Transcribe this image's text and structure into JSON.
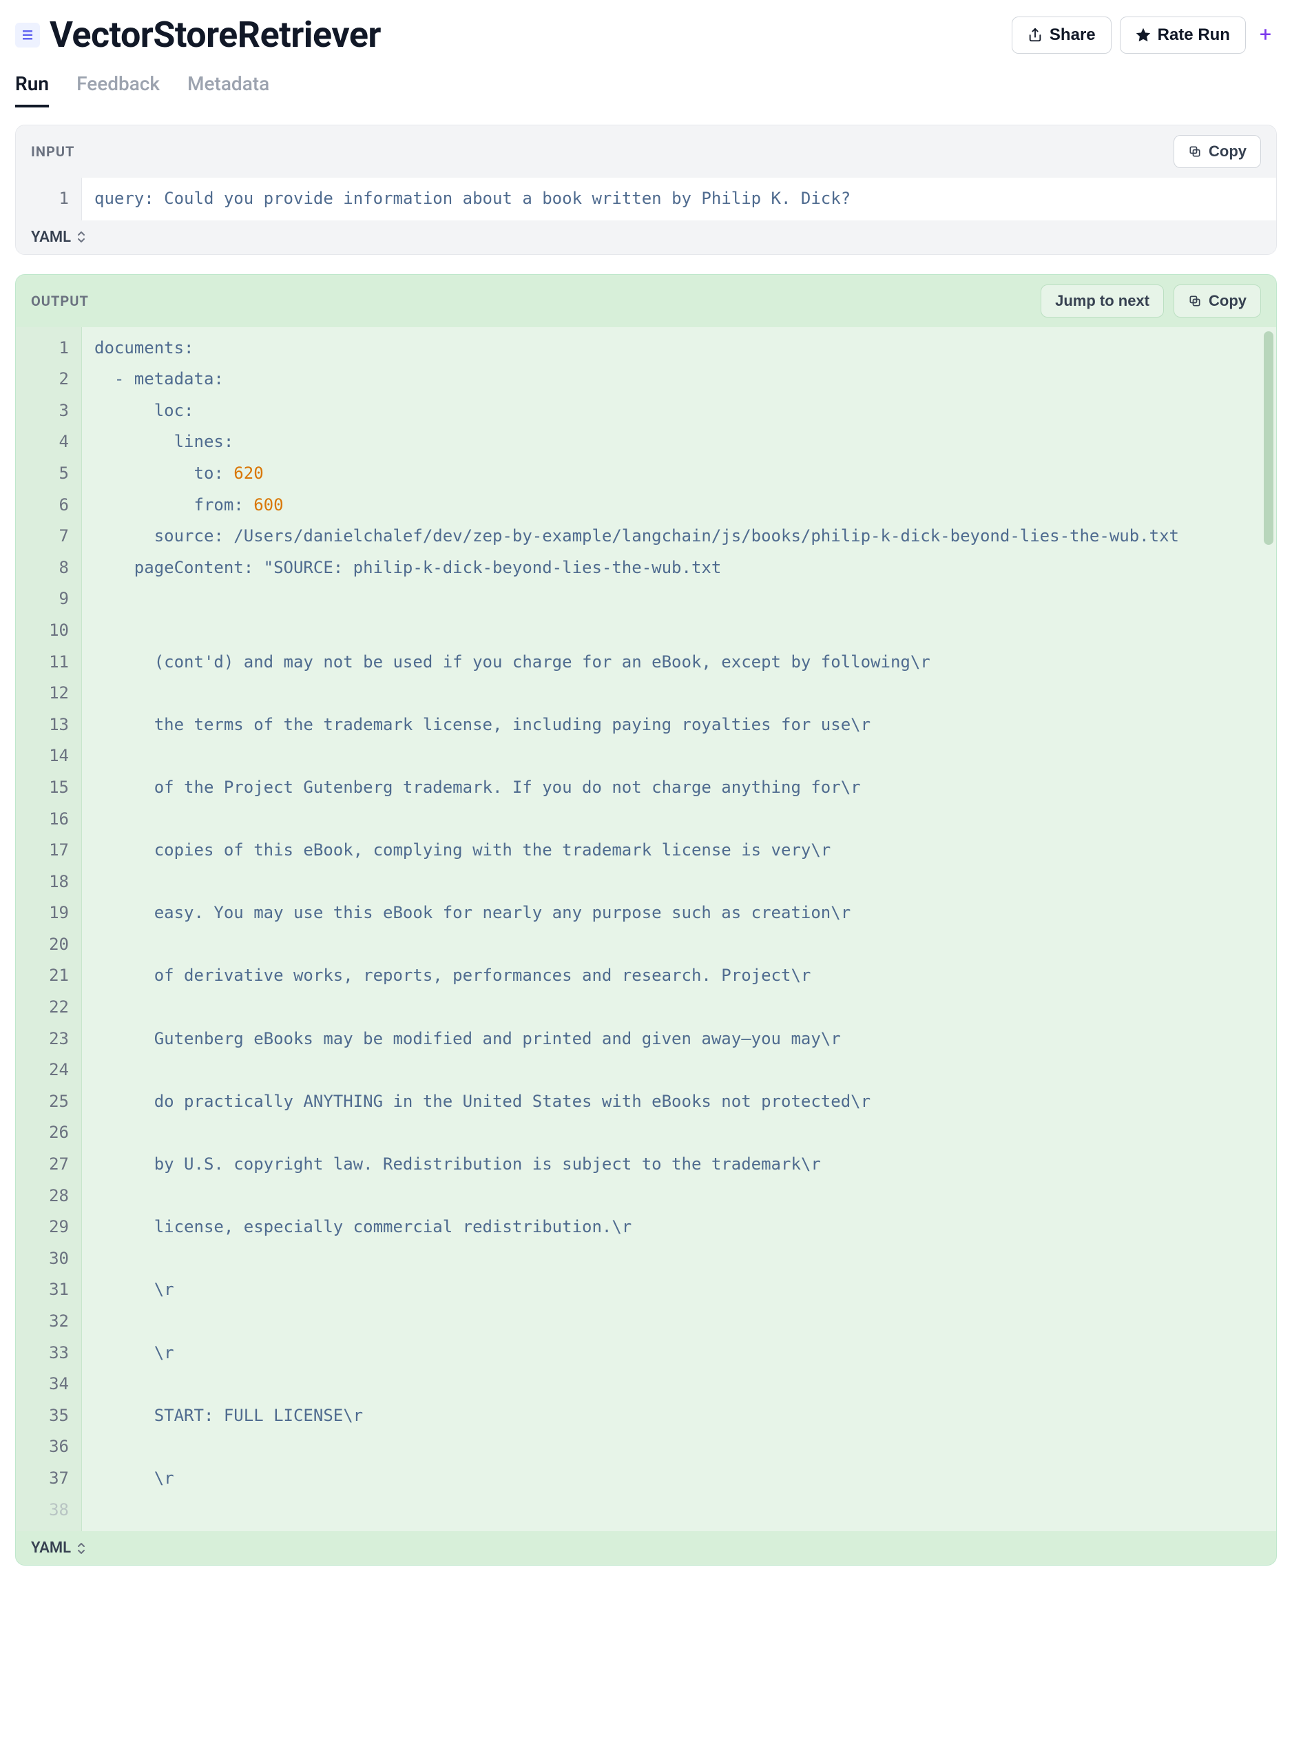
{
  "header": {
    "title": "VectorStoreRetriever",
    "share_label": "Share",
    "rate_label": "Rate Run"
  },
  "tabs": {
    "run": "Run",
    "feedback": "Feedback",
    "metadata": "Metadata"
  },
  "input_panel": {
    "label": "INPUT",
    "copy_label": "Copy",
    "format_label": "YAML",
    "line_numbers": [
      "1"
    ],
    "code": {
      "key": "query",
      "colon": ": ",
      "value": "Could you provide information about a book written by Philip K. Dick?"
    }
  },
  "output_panel": {
    "label": "OUTPUT",
    "jump_label": "Jump to next",
    "copy_label": "Copy",
    "format_label": "YAML",
    "line_numbers": [
      "1",
      "2",
      "3",
      "4",
      "5",
      "6",
      "7",
      "8",
      "9",
      "10",
      "11",
      "12",
      "13",
      "14",
      "15",
      "16",
      "17",
      "18",
      "19",
      "20",
      "21",
      "22",
      "23",
      "24",
      "25",
      "26",
      "27",
      "28",
      "29",
      "30",
      "31",
      "32",
      "33",
      "34",
      "35",
      "36",
      "37",
      "38"
    ],
    "lines": {
      "l1": "documents:",
      "l2": "  - metadata:",
      "l3": "      loc:",
      "l4": "        lines:",
      "l5a": "          to: ",
      "l5b": "620",
      "l6a": "          from: ",
      "l6b": "600",
      "l7": "      source: /Users/danielchalef/dev/zep-by-example/langchain/js/books/philip-k-dick-beyond-lies-the-wub.txt",
      "l8": "    pageContent: \"SOURCE: philip-k-dick-beyond-lies-the-wub.txt",
      "l9": "",
      "l10": "",
      "l11": "      (cont'd) and may not be used if you charge for an eBook, except by following\\r",
      "l12": "",
      "l13": "      the terms of the trademark license, including paying royalties for use\\r",
      "l14": "",
      "l15": "      of the Project Gutenberg trademark. If you do not charge anything for\\r",
      "l16": "",
      "l17": "      copies of this eBook, complying with the trademark license is very\\r",
      "l18": "",
      "l19": "      easy. You may use this eBook for nearly any purpose such as creation\\r",
      "l20": "",
      "l21": "      of derivative works, reports, performances and research. Project\\r",
      "l22": "",
      "l23": "      Gutenberg eBooks may be modified and printed and given away—you may\\r",
      "l24": "",
      "l25": "      do practically ANYTHING in the United States with eBooks not protected\\r",
      "l26": "",
      "l27": "      by U.S. copyright law. Redistribution is subject to the trademark\\r",
      "l28": "",
      "l29": "      license, especially commercial redistribution.\\r",
      "l30": "",
      "l31": "      \\r",
      "l32": "",
      "l33": "      \\r",
      "l34": "",
      "l35": "      START: FULL LICENSE\\r",
      "l36": "",
      "l37": "      \\r"
    }
  }
}
